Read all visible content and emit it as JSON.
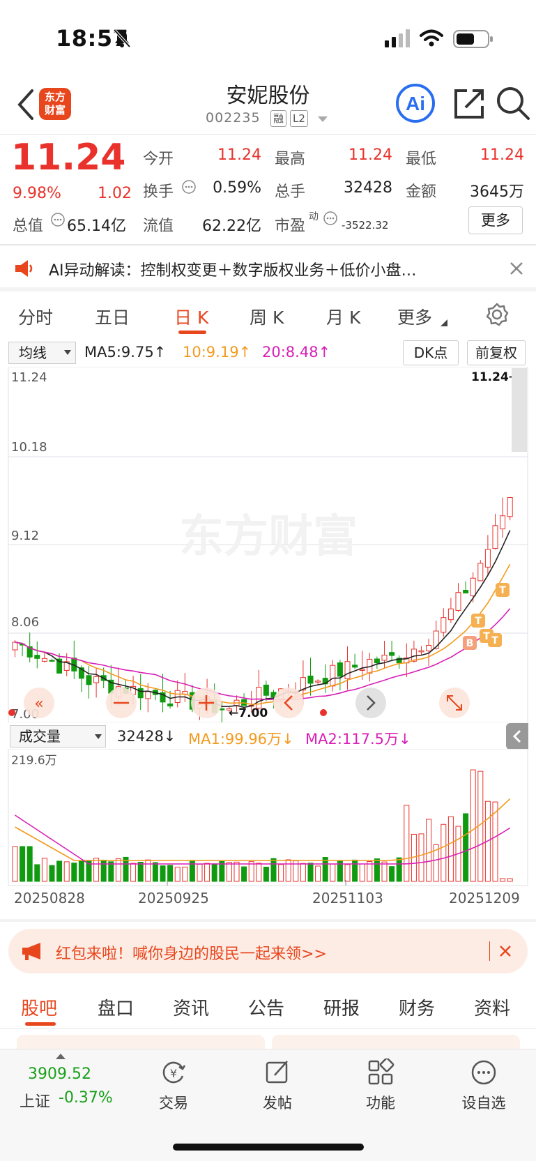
{
  "status": {
    "time": "18:57"
  },
  "header": {
    "logo_text": "东方财富",
    "stock_name": "安妮股份",
    "stock_code": "002235",
    "tags": [
      "融",
      "L2"
    ],
    "ai_label": "Ai"
  },
  "quote": {
    "price": "11.24",
    "change_pct": "9.98%",
    "change_val": "1.02",
    "fields": [
      {
        "label": "今开",
        "value": "11.24",
        "color": "red"
      },
      {
        "label": "最高",
        "value": "11.24",
        "color": "red"
      },
      {
        "label": "最低",
        "value": "11.24",
        "color": "red"
      },
      {
        "label": "换手",
        "value": "0.59%",
        "color": "dark"
      },
      {
        "label": "总手",
        "value": "32428",
        "color": "dark"
      },
      {
        "label": "金额",
        "value": "3645万",
        "color": "dark"
      },
      {
        "label": "总值",
        "value": "65.14亿",
        "color": "dark"
      },
      {
        "label": "流值",
        "value": "62.22亿",
        "color": "dark"
      },
      {
        "label": "市盈",
        "value": "-3522.32",
        "color": "dark"
      }
    ],
    "pe_sup": "动",
    "more": "更多"
  },
  "ai_bar": {
    "text": "AI异动解读：控制权变更＋数字版权业务＋低价小盘…"
  },
  "period_tabs": [
    "分时",
    "五日",
    "日 K",
    "周 K",
    "月 K",
    "更多"
  ],
  "active_period": "日 K",
  "ma_row": {
    "select": "均线",
    "ma5": "MA5:9.75↑",
    "ma10": "10:9.19↑",
    "ma20": "20:8.48↑",
    "dk": "DK点",
    "fq": "前复权",
    "colors": {
      "ma5": "#222222",
      "ma10": "#f39a1e",
      "ma20": "#d81fb6"
    }
  },
  "kline_axis": {
    "labels": [
      "11.24",
      "10.18",
      "9.12",
      "8.06",
      "7.00"
    ],
    "high_mark": "11.24→",
    "low_mark": "←7.00",
    "watermark": "东方财富"
  },
  "volume_row": {
    "select": "成交量",
    "vol": "32428↓",
    "ma1": "MA1:99.96万↓",
    "ma2": "MA2:117.5万↓",
    "max_label": "219.6万"
  },
  "dates": [
    "20250828",
    "20250925",
    "20251103",
    "20251209"
  ],
  "promo": {
    "text": "红包来啦！喊你身边的股民一起来领>>"
  },
  "bottom_tabs": [
    "股吧",
    "盘口",
    "资讯",
    "公告",
    "研报",
    "财务",
    "资料"
  ],
  "index": {
    "value": "3909.52",
    "name": "上证",
    "change": "-0.37%"
  },
  "bottom_bar": [
    "交易",
    "发帖",
    "功能",
    "设自选"
  ],
  "chart_data": {
    "type": "candlestick",
    "series": [
      {
        "name": "MA5",
        "value": 9.75
      },
      {
        "name": "MA10",
        "value": 9.19
      },
      {
        "name": "MA20",
        "value": 8.48
      }
    ],
    "ylim": [
      7.0,
      11.24
    ],
    "ticks": [
      "11.24",
      "10.18",
      "9.12",
      "8.06",
      "7.00"
    ],
    "x": [
      "20250828",
      "20250925",
      "20251103",
      "20251209"
    ],
    "volume_max": "219.6万"
  }
}
